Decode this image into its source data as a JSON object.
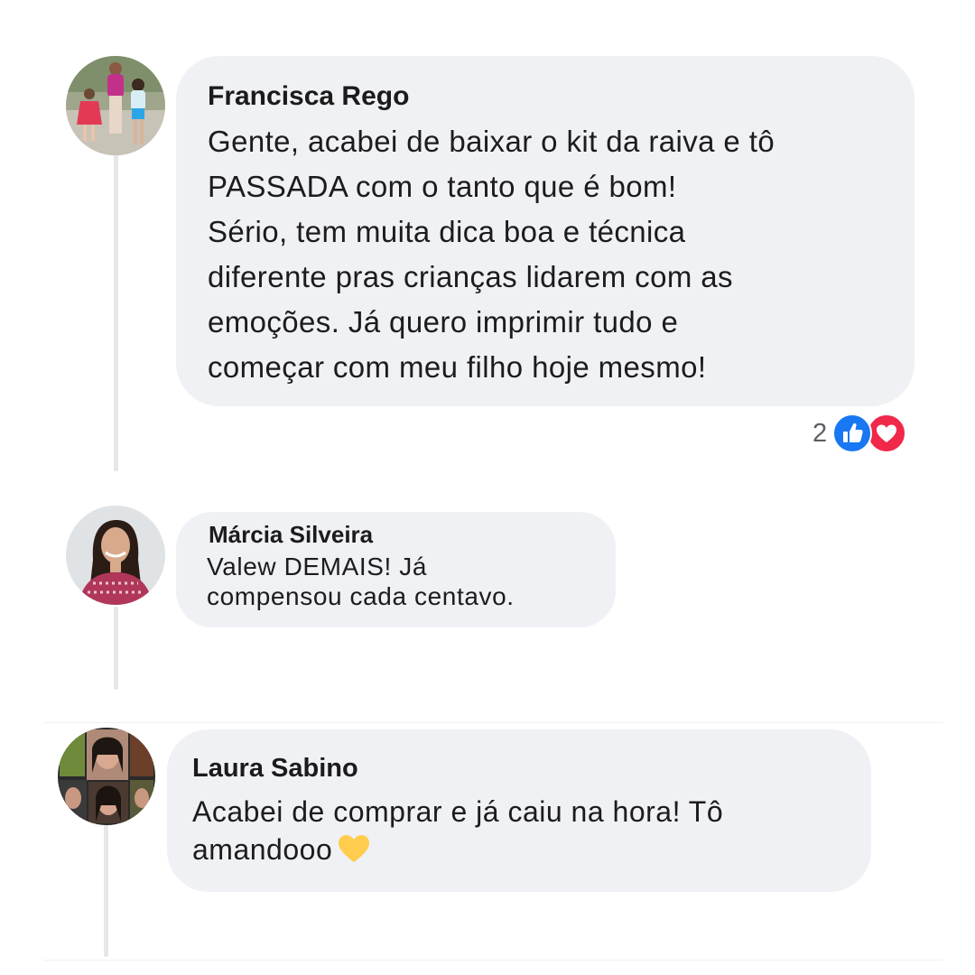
{
  "comments": [
    {
      "author": "Francisca Rego",
      "text": "Gente, acabei de baixar o kit da raiva e tô\nPASSADA com o tanto que é bom!\nSério, tem muita dica boa e técnica\ndiferente pras crianças lidarem com as\nemoções. Já quero imprimir tudo e\ncomeçar com meu filho hoje mesmo!",
      "reaction_count": "2",
      "reactions": [
        "like-icon",
        "love-icon"
      ]
    },
    {
      "author": "Márcia Silveira",
      "text": "Valew DEMAIS! Já\ncompensou cada centavo."
    },
    {
      "author": "Laura Sabino",
      "text": "Acabei de comprar e já caiu na hora! Tô\namandooo",
      "emoji": "yellow-heart-icon"
    }
  ],
  "colors": {
    "bubble": "#f0f1f5",
    "like": "#1877f2",
    "love": "#f0284a",
    "yellow_heart": "#ffcc4d"
  }
}
